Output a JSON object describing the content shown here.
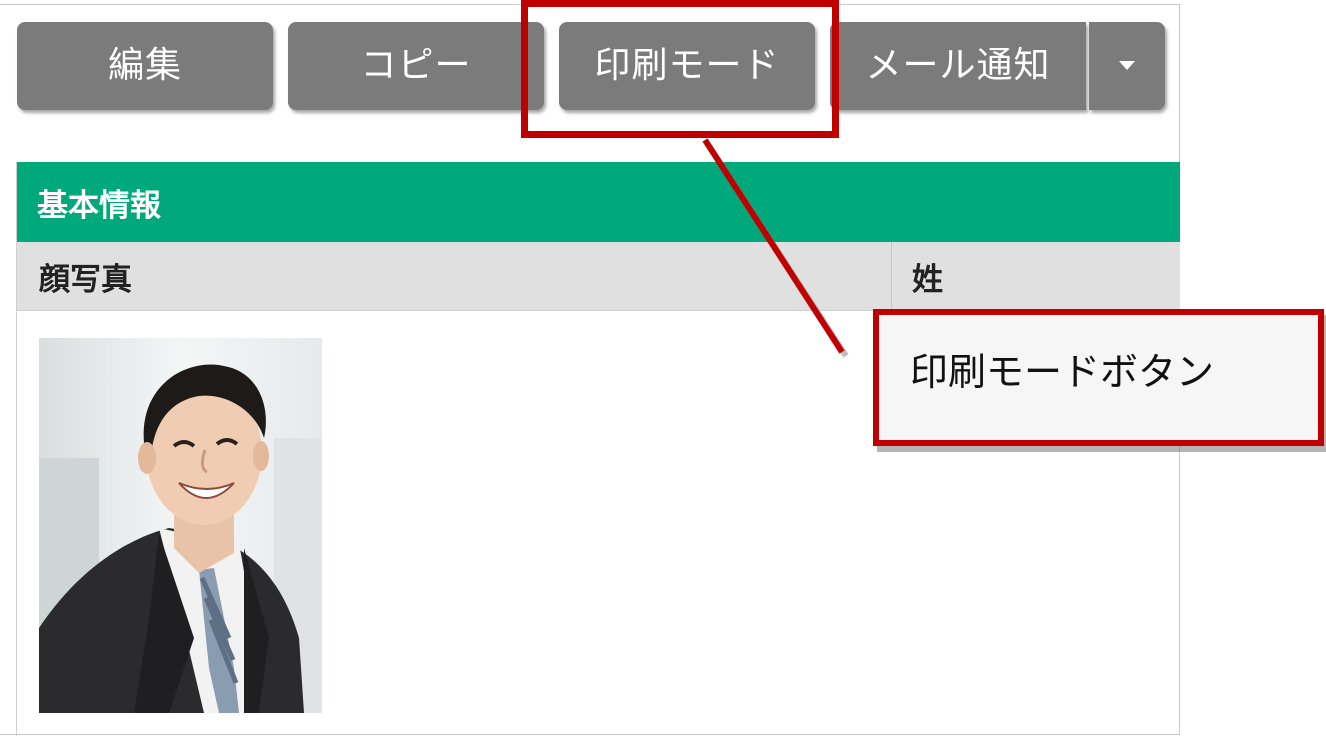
{
  "toolbar": {
    "edit_label": "編集",
    "copy_label": "コピー",
    "print_mode_label": "印刷モード",
    "mail_notify_label": "メール通知"
  },
  "section": {
    "title": "基本情報",
    "columns": [
      "顔写真",
      "姓"
    ]
  },
  "callout": {
    "text": "印刷モードボタン"
  },
  "colors": {
    "button_bg": "#7b7b7b",
    "section_header": "#00a97b",
    "highlight": "#c00000"
  }
}
